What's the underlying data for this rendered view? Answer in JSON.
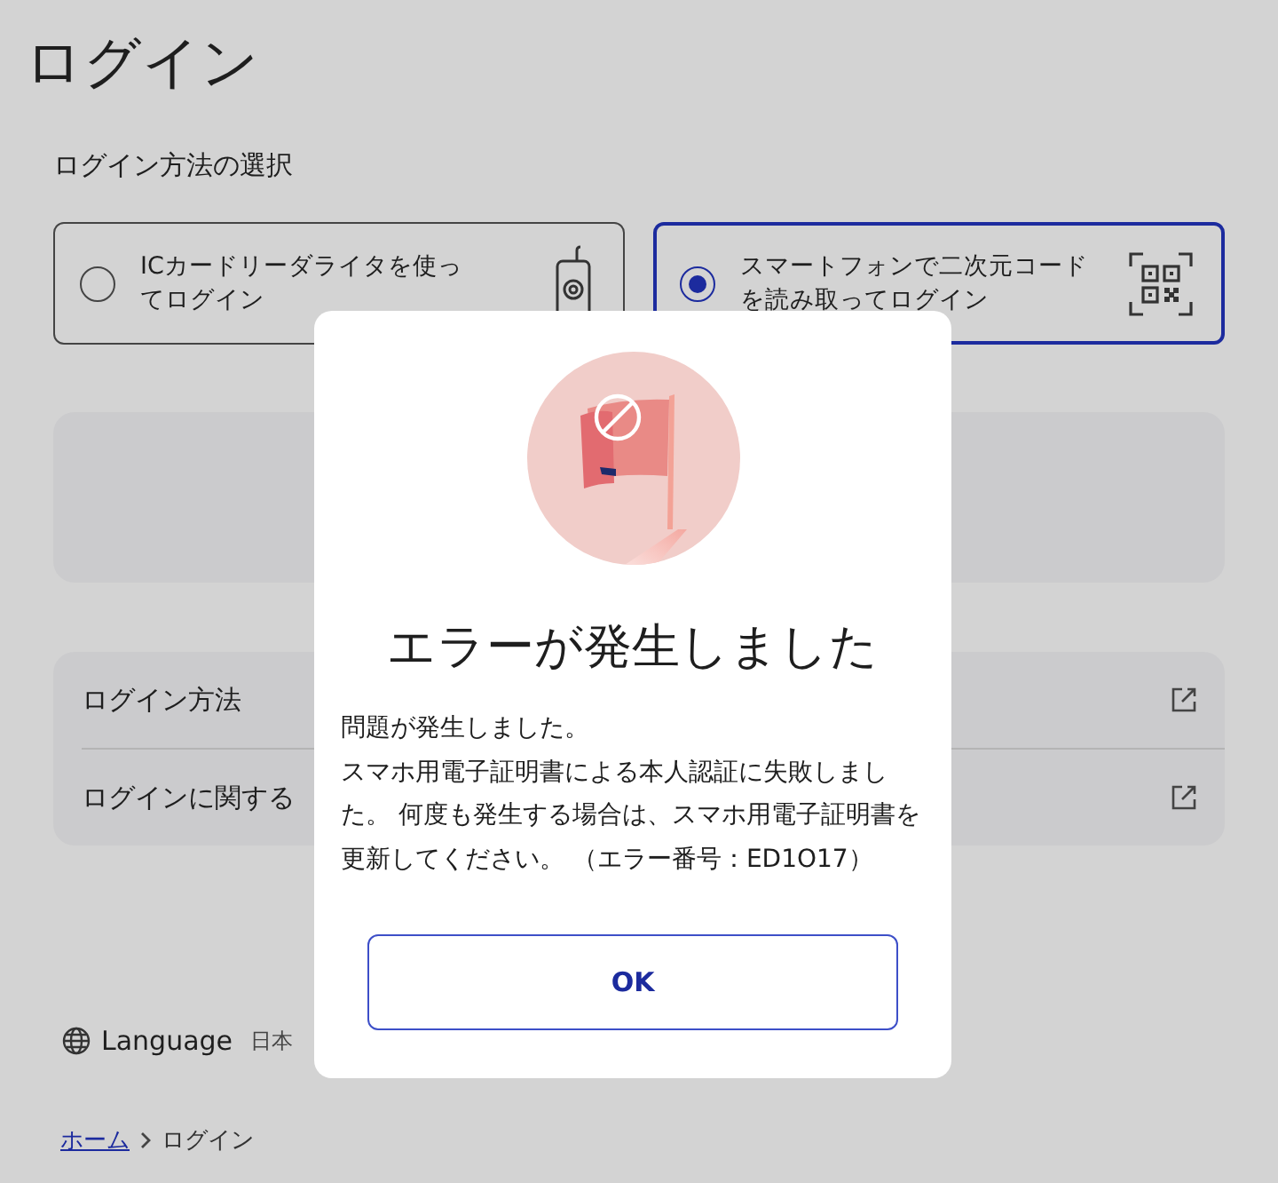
{
  "page": {
    "title": "ログイン",
    "section_label": "ログイン方法の選択",
    "options": [
      {
        "label": "ICカードリーダライタを使ってログイン",
        "selected": false,
        "kind": "card-reader"
      },
      {
        "label": "スマートフォンで二次元コードを読み取ってログイン",
        "selected": true,
        "kind": "qr"
      }
    ],
    "links": [
      {
        "label": "ログイン方法"
      },
      {
        "label": "ログインに関する"
      }
    ],
    "language": {
      "label": "Language",
      "value": "日本"
    },
    "breadcrumb": [
      {
        "label": "ホーム",
        "link": true
      },
      {
        "label": "ログイン",
        "link": false
      }
    ]
  },
  "dialog": {
    "title": "エラーが発生しました",
    "message": [
      "問題が発生しました。",
      "スマホ用電子証明書による本人認証に失敗しました。 何度も発生する場合は、スマホ用電子証明書を更新してください。 （エラー番号：ED1O17）"
    ],
    "button": "OK"
  }
}
